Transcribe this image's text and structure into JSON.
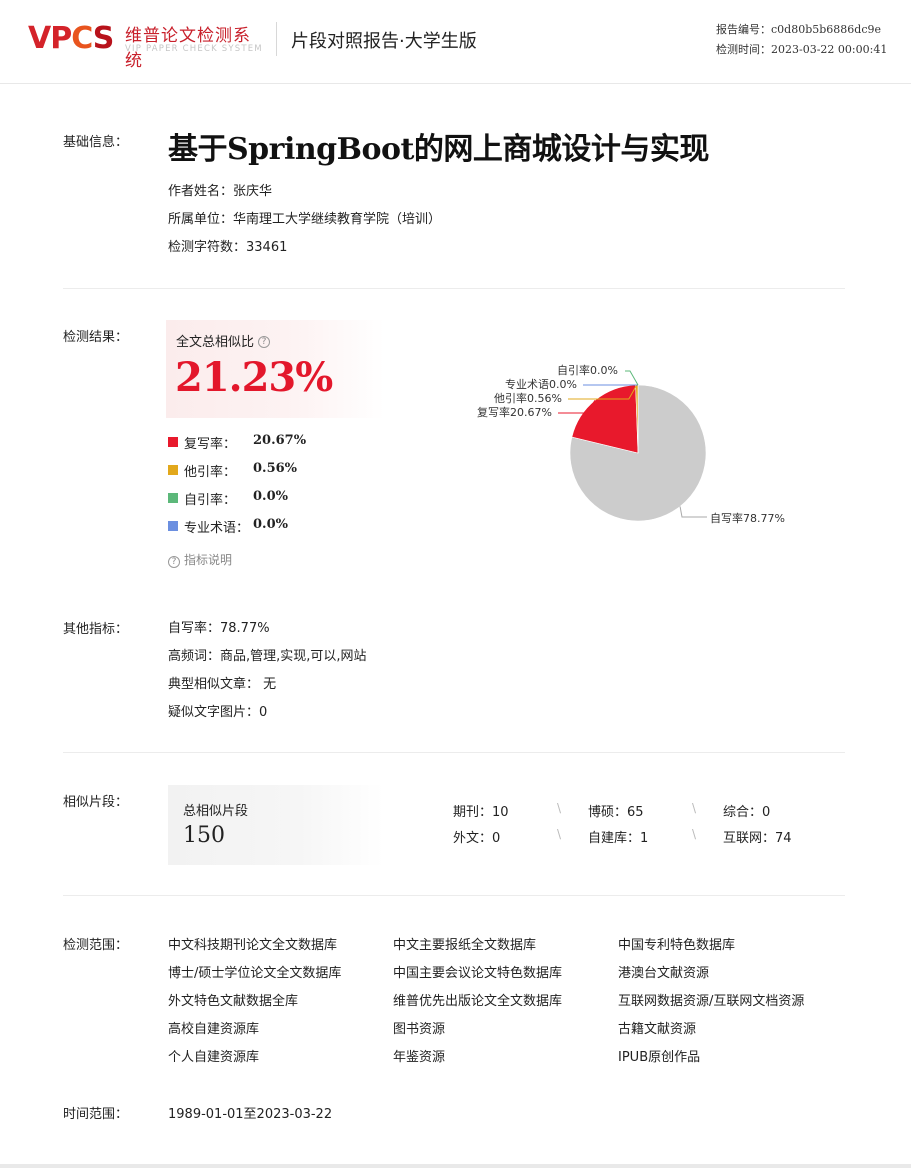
{
  "header": {
    "logo_mark": "VPCS",
    "logo_cn": "维普论文检测系统",
    "logo_en": "VIP PAPER CHECK SYSTEM",
    "report_title": "片段对照报告·大学生版",
    "report_no": "报告编号：c0d80b5b6886dc9e",
    "check_time": "检测时间：2023-03-22 00:00:41"
  },
  "basic": {
    "label": "基础信息：",
    "title": "基于SpringBoot的网上商城设计与实现",
    "author": "作者姓名：张庆华",
    "unit": "所属单位：华南理工大学继续教育学院（培训）",
    "chars": "检测字符数：33461"
  },
  "result": {
    "label": "检测结果：",
    "similarity_label": "全文总相似比",
    "similarity_value": "21.23%",
    "help_icon": "question-circle-icon",
    "legend": [
      {
        "name": "复写率：",
        "value": "20.67%",
        "color": "#e8192c"
      },
      {
        "name": "他引率：",
        "value": "0.56%",
        "color": "#e2a81c"
      },
      {
        "name": "自引率：",
        "value": "0.0%",
        "color": "#5cb87a"
      },
      {
        "name": "专业术语：",
        "value": "0.0%",
        "color": "#6b8fe0"
      }
    ],
    "metric_help": "指标说明"
  },
  "chart_data": {
    "type": "pie",
    "slices": [
      {
        "label": "自写率78.77%",
        "value": 78.77,
        "color": "#cccccc"
      },
      {
        "label": "复写率20.67%",
        "value": 20.67,
        "color": "#e8192c"
      },
      {
        "label": "他引率0.56%",
        "value": 0.56,
        "color": "#e2a81c"
      },
      {
        "label": "专业术语0.0%",
        "value": 0.0,
        "color": "#6b8fe0"
      },
      {
        "label": "自引率0.0%",
        "value": 0.0,
        "color": "#5cb87a"
      }
    ]
  },
  "other": {
    "label": "其他指标：",
    "self_write": "自写率：78.77%",
    "keywords": "高频词：商品,管理,实现,可以,网站",
    "typical": "典型相似文章： 无",
    "images": "疑似文字图片：0"
  },
  "segments": {
    "label": "相似片段：",
    "total_label": "总相似片段",
    "total": "150",
    "sep": "\\",
    "stats": [
      "期刊：10",
      "博硕：65",
      "综合：0",
      "外文：0",
      "自建库：1",
      "互联网：74"
    ]
  },
  "scope": {
    "label": "检测范围：",
    "items": [
      "中文科技期刊论文全文数据库",
      "中文主要报纸全文数据库",
      "中国专利特色数据库",
      "博士/硕士学位论文全文数据库",
      "中国主要会议论文特色数据库",
      "港澳台文献资源",
      "外文特色文献数据全库",
      "维普优先出版论文全文数据库",
      "互联网数据资源/互联网文档资源",
      "高校自建资源库",
      "图书资源",
      "古籍文献资源",
      "个人自建资源库",
      "年鉴资源",
      "IPUB原创作品"
    ]
  },
  "time_range": {
    "label": "时间范围：",
    "value": "1989-01-01至2023-03-22"
  }
}
